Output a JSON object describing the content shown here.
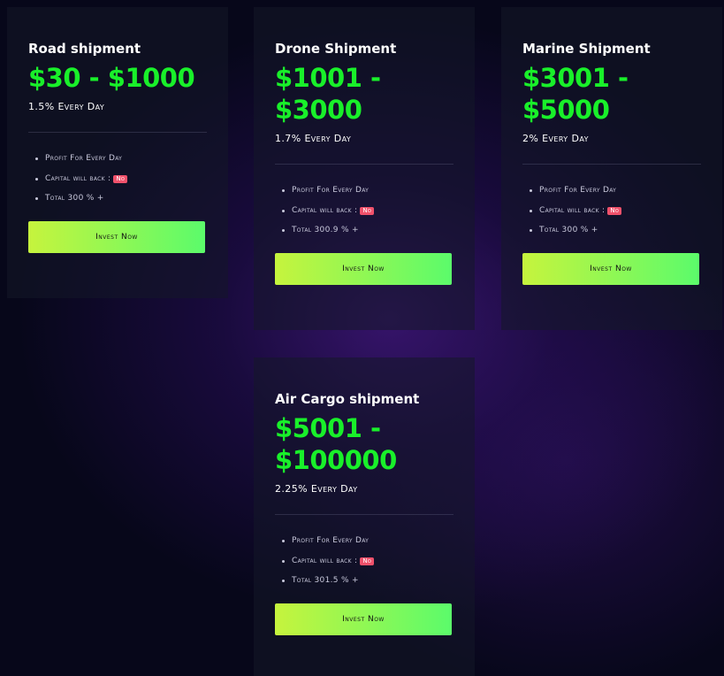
{
  "plans": [
    {
      "title": "Road shipment",
      "price_line1": "$30 - $1000",
      "price_line2": "",
      "rate": "1.5% Every Day",
      "feature_profit": "Profit For Every Day",
      "feature_capital": "Capital will back :",
      "capital_badge": "No",
      "feature_total": "Total 300 % +",
      "button_label": "Invest Now"
    },
    {
      "title": "Drone Shipment",
      "price_line1": "$1001 -",
      "price_line2": "$3000",
      "rate": "1.7% Every Day",
      "feature_profit": "Profit For Every Day",
      "feature_capital": "Capital will back :",
      "capital_badge": "No",
      "feature_total": "Total 300.9 % +",
      "button_label": "Invest Now"
    },
    {
      "title": "Marine Shipment",
      "price_line1": "$3001 -",
      "price_line2": "$5000",
      "rate": "2% Every Day",
      "feature_profit": "Profit For Every Day",
      "feature_capital": "Capital will back :",
      "capital_badge": "No",
      "feature_total": "Total 300 % +",
      "button_label": "Invest Now"
    },
    {
      "title": "Air Cargo shipment",
      "price_line1": "$5001 -",
      "price_line2": "$100000",
      "rate": "2.25% Every Day",
      "feature_profit": "Profit For Every Day",
      "feature_capital": "Capital will back :",
      "capital_badge": "No",
      "feature_total": "Total 301.5 % +",
      "button_label": "Invest Now"
    }
  ],
  "colors": {
    "price": "#19f02a",
    "badge": "#f0516b",
    "button_start": "#c6f43d",
    "button_end": "#5bfb6b"
  }
}
